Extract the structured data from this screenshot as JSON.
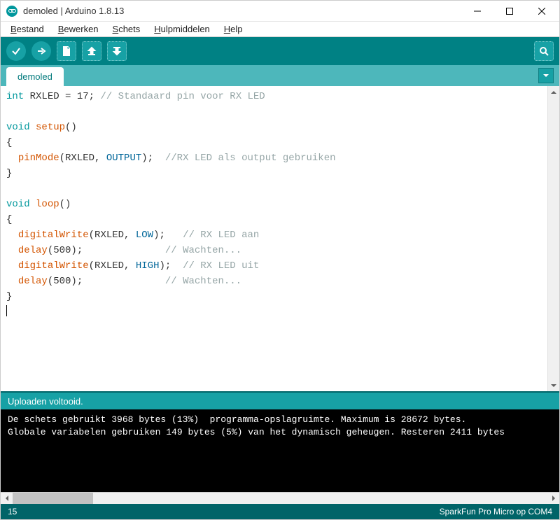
{
  "window": {
    "title": "demoled | Arduino 1.8.13"
  },
  "menu": {
    "items": [
      "Bestand",
      "Bewerken",
      "Schets",
      "Hulpmiddelen",
      "Help"
    ]
  },
  "toolbar": {
    "verify": "verify",
    "upload": "upload",
    "new": "new",
    "open": "open",
    "save": "save",
    "monitor": "serial-monitor"
  },
  "tabs": {
    "items": [
      "demoled"
    ]
  },
  "code": {
    "tokens": [
      {
        "t": "kw-type",
        "v": "int"
      },
      {
        "t": "",
        "v": " RXLED = "
      },
      {
        "t": "num",
        "v": "17"
      },
      {
        "t": "",
        "v": "; "
      },
      {
        "t": "comment",
        "v": "// Standaard pin voor RX LED"
      },
      {
        "t": "nl"
      },
      {
        "t": "nl"
      },
      {
        "t": "kw-type",
        "v": "void"
      },
      {
        "t": "",
        "v": " "
      },
      {
        "t": "fn",
        "v": "setup"
      },
      {
        "t": "",
        "v": "()"
      },
      {
        "t": "nl"
      },
      {
        "t": "",
        "v": "{"
      },
      {
        "t": "nl"
      },
      {
        "t": "",
        "v": "  "
      },
      {
        "t": "fn",
        "v": "pinMode"
      },
      {
        "t": "",
        "v": "(RXLED, "
      },
      {
        "t": "kw-const",
        "v": "OUTPUT"
      },
      {
        "t": "",
        "v": ");  "
      },
      {
        "t": "comment",
        "v": "//RX LED als output gebruiken"
      },
      {
        "t": "nl"
      },
      {
        "t": "",
        "v": "}"
      },
      {
        "t": "nl"
      },
      {
        "t": "nl"
      },
      {
        "t": "kw-type",
        "v": "void"
      },
      {
        "t": "",
        "v": " "
      },
      {
        "t": "fn",
        "v": "loop"
      },
      {
        "t": "",
        "v": "()"
      },
      {
        "t": "nl"
      },
      {
        "t": "",
        "v": "{"
      },
      {
        "t": "nl"
      },
      {
        "t": "",
        "v": "  "
      },
      {
        "t": "fn",
        "v": "digitalWrite"
      },
      {
        "t": "",
        "v": "(RXLED, "
      },
      {
        "t": "kw-const",
        "v": "LOW"
      },
      {
        "t": "",
        "v": ");   "
      },
      {
        "t": "comment",
        "v": "// RX LED aan"
      },
      {
        "t": "nl"
      },
      {
        "t": "",
        "v": "  "
      },
      {
        "t": "fn",
        "v": "delay"
      },
      {
        "t": "",
        "v": "(500);              "
      },
      {
        "t": "comment",
        "v": "// Wachten..."
      },
      {
        "t": "nl"
      },
      {
        "t": "",
        "v": "  "
      },
      {
        "t": "fn",
        "v": "digitalWrite"
      },
      {
        "t": "",
        "v": "(RXLED, "
      },
      {
        "t": "kw-const",
        "v": "HIGH"
      },
      {
        "t": "",
        "v": ");  "
      },
      {
        "t": "comment",
        "v": "// RX LED uit"
      },
      {
        "t": "nl"
      },
      {
        "t": "",
        "v": "  "
      },
      {
        "t": "fn",
        "v": "delay"
      },
      {
        "t": "",
        "v": "(500);              "
      },
      {
        "t": "comment",
        "v": "// Wachten..."
      },
      {
        "t": "nl"
      },
      {
        "t": "",
        "v": "}"
      },
      {
        "t": "nl"
      }
    ]
  },
  "status": {
    "message": "Uploaden voltooid."
  },
  "console": {
    "lines": [
      "De schets gebruikt 3968 bytes (13%)  programma-opslagruimte. Maximum is 28672 bytes.",
      "Globale variabelen gebruiken 149 bytes (5%) van het dynamisch geheugen. Resteren 2411 bytes"
    ]
  },
  "bottom": {
    "line": "15",
    "board": "SparkFun Pro Micro op COM4"
  }
}
